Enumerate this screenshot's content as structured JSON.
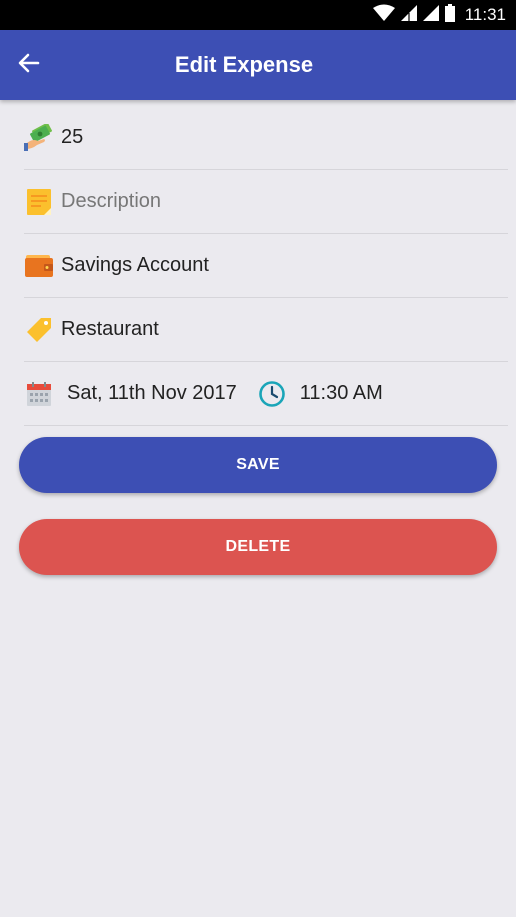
{
  "status_bar": {
    "time": "11:31"
  },
  "app_bar": {
    "title": "Edit Expense"
  },
  "form": {
    "amount": "25",
    "description_placeholder": "Description",
    "account": "Savings Account",
    "category": "Restaurant",
    "date": "Sat, 11th Nov 2017",
    "time": "11:30 AM"
  },
  "buttons": {
    "save": "SAVE",
    "delete": "DELETE"
  },
  "colors": {
    "primary": "#3d4fb4",
    "danger": "#dc5450",
    "background": "#ebeaef"
  }
}
